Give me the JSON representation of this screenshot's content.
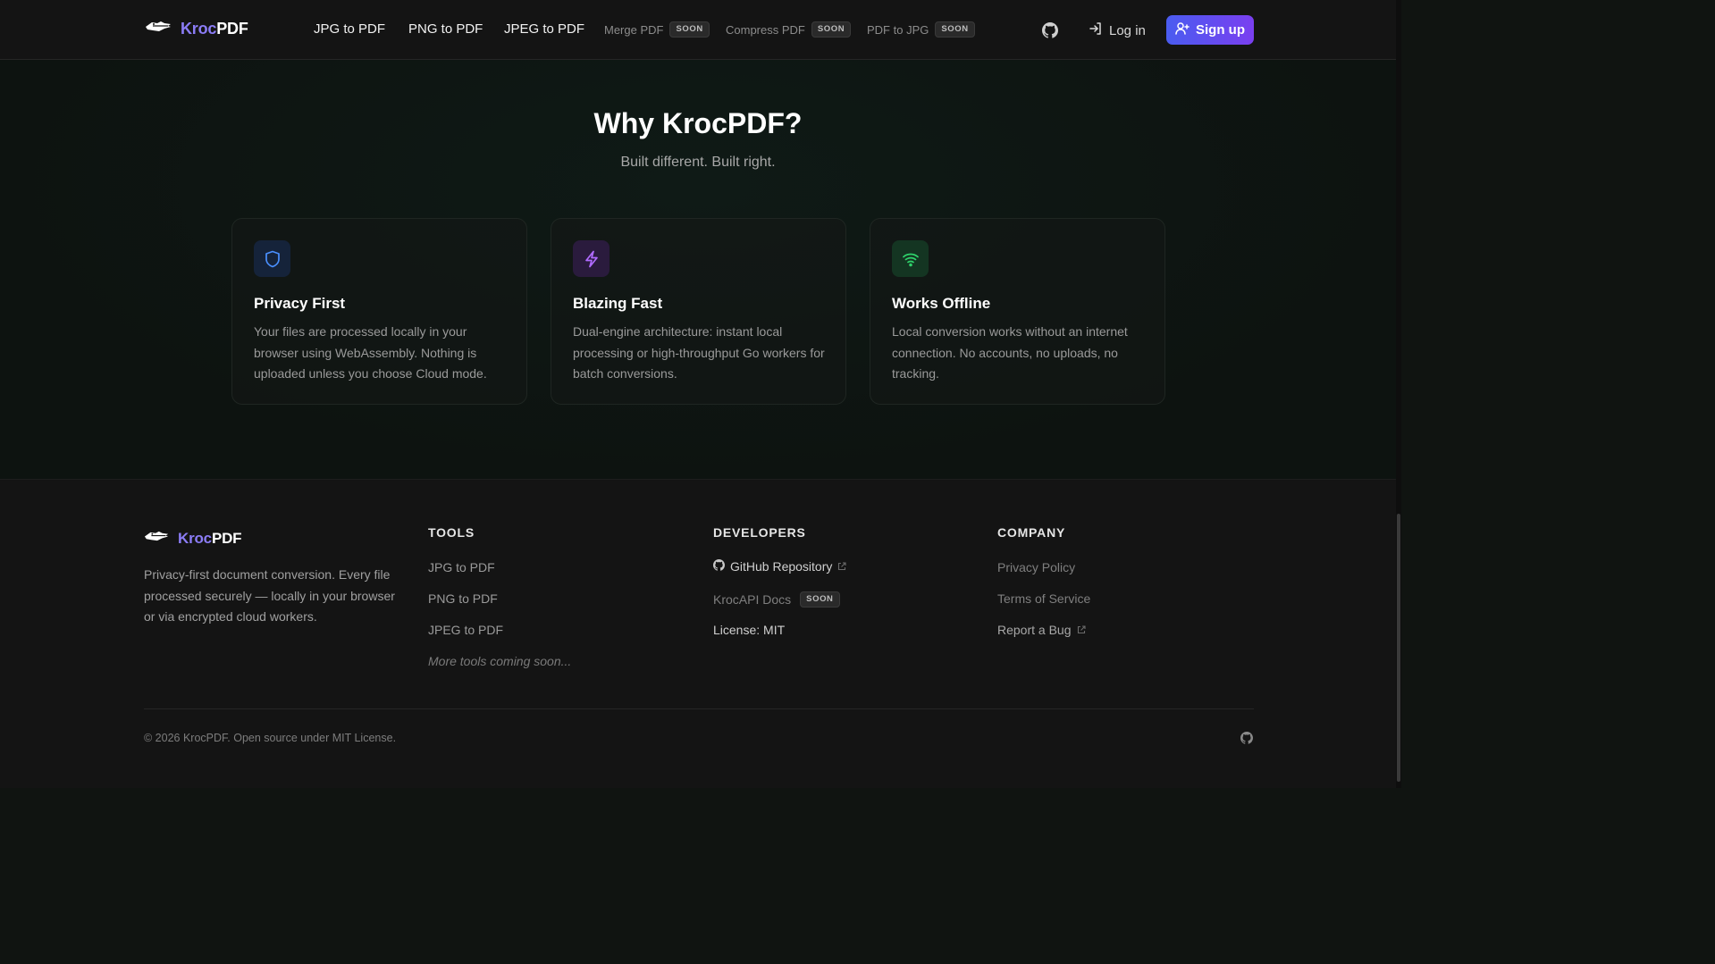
{
  "header": {
    "brand": {
      "part1": "Kroc",
      "part2": "PDF",
      "logo_icon": "crocodile-icon"
    },
    "nav": [
      {
        "label": "JPG to PDF"
      },
      {
        "label": "PNG to PDF"
      },
      {
        "label": "JPEG to PDF"
      }
    ],
    "nav_soon": [
      {
        "label": "Merge PDF",
        "badge": "SOON"
      },
      {
        "label": "Compress PDF",
        "badge": "SOON"
      },
      {
        "label": "PDF to JPG",
        "badge": "SOON"
      }
    ],
    "github_icon": "github-icon",
    "login_label": "Log in",
    "signup_label": "Sign up"
  },
  "main": {
    "title": "Why KrocPDF?",
    "subtitle": "Built different. Built right.",
    "cards": [
      {
        "icon": "shield-icon",
        "title": "Privacy First",
        "desc": "Your files are processed locally in your browser using WebAssembly. Nothing is uploaded unless you choose Cloud mode.",
        "accent": "#3b82f6"
      },
      {
        "icon": "lightning-icon",
        "title": "Blazing Fast",
        "desc": "Dual-engine architecture: instant local processing or high-throughput Go workers for batch conversions.",
        "accent": "#a855f7"
      },
      {
        "icon": "wifi-icon",
        "title": "Works Offline",
        "desc": "Local conversion works without an internet connection. No accounts, no uploads, no tracking.",
        "accent": "#22c55e"
      }
    ]
  },
  "footer": {
    "brand": {
      "part1": "Kroc",
      "part2": "PDF"
    },
    "description": "Privacy-first document conversion. Every file processed securely — locally in your browser or via encrypted cloud workers.",
    "tools": {
      "heading": "TOOLS",
      "links": [
        "JPG to PDF",
        "PNG to PDF",
        "JPEG to PDF"
      ],
      "more": "More tools coming soon..."
    },
    "developers": {
      "heading": "DEVELOPERS",
      "github": "GitHub Repository",
      "api": "KrocAPI Docs",
      "api_badge": "SOON",
      "license": "License: MIT"
    },
    "company": {
      "heading": "COMPANY",
      "privacy": "Privacy Policy",
      "terms": "Terms of Service",
      "bug": "Report a Bug"
    },
    "copyright": "© 2026 KrocPDF. Open source under MIT License."
  },
  "colors": {
    "accent_purple": "#8b7cf6",
    "signup_from": "#4a5cf0",
    "signup_to": "#7a3ff0"
  }
}
